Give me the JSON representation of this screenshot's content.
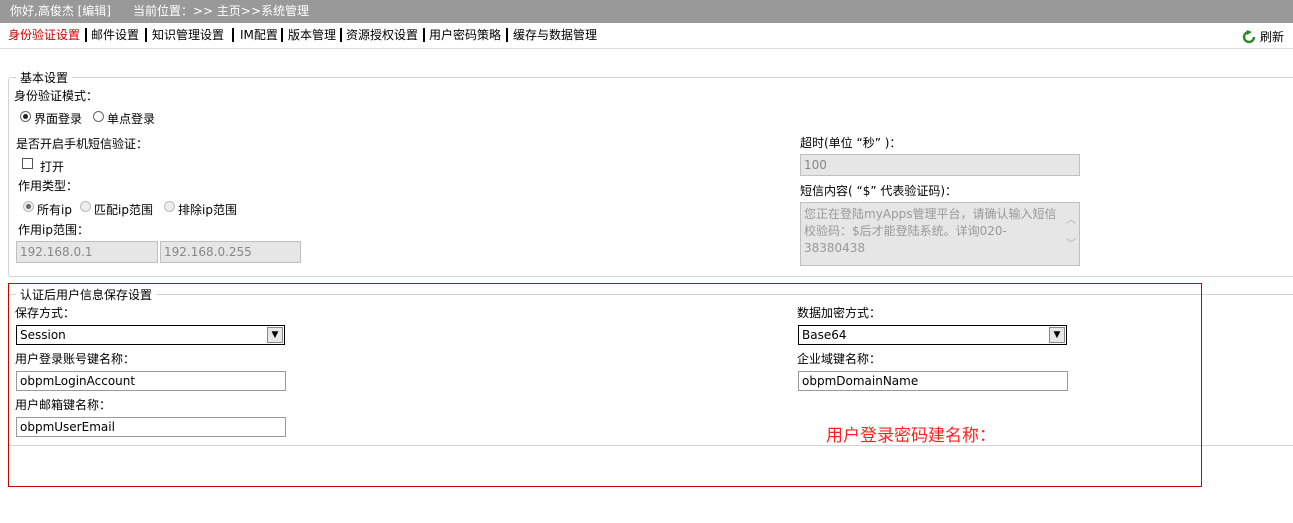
{
  "header": {
    "greeting": "你好,高俊杰 [编辑]",
    "location": "当前位置：>> 主页>>系统管理"
  },
  "tabs": [
    {
      "label": "身份验证设置",
      "active": true
    },
    {
      "label": "邮件设置"
    },
    {
      "label": "知识管理设置"
    },
    {
      "label": "IM配置"
    },
    {
      "label": "版本管理"
    },
    {
      "label": "资源授权设置"
    },
    {
      "label": "用户密码策略"
    },
    {
      "label": "缓存与数据管理"
    }
  ],
  "refresh_label": "刷新",
  "basic": {
    "legend": "基本设置",
    "auth_mode_label": "身份验证模式：",
    "auth_modes": [
      "界面登录",
      "单点登录"
    ],
    "sms_label": "是否开启手机短信验证：",
    "open_label": "打开",
    "scope_type_label": "作用类型：",
    "scope_types": [
      "所有ip",
      "匹配ip范围",
      "排除ip范围"
    ],
    "ip_range_label": "作用ip范围：",
    "ip_start": "192.168.0.1",
    "ip_end": "192.168.0.255",
    "timeout_label": "超时(单位 “秒” )：",
    "timeout_value": "100",
    "sms_content_label": "短信内容( “$” 代表验证码)：",
    "sms_content": "您正在登陆myApps管理平台，请确认输入短信校验码：$后才能登陆系统。详询020-38380438"
  },
  "user_info": {
    "legend": "认证后用户信息保存设置",
    "save_method_label": "保存方式：",
    "save_method": "Session",
    "encrypt_label": "数据加密方式：",
    "encrypt_method": "Base64",
    "account_key_label": "用户登录账号键名称：",
    "account_key": "obpmLoginAccount",
    "domain_key_label": "企业域键名称：",
    "domain_key": "obpmDomainName",
    "email_key_label": "用户邮箱键名称：",
    "email_key": "obpmUserEmail",
    "annotation": "用户登录密码建名称："
  }
}
